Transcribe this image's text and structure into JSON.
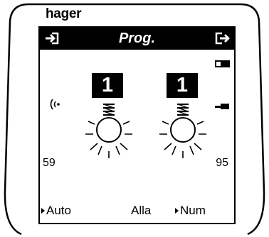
{
  "brand": "hager",
  "title": "Prog.",
  "icons": {
    "left": "login-arrow-icon",
    "right": "exit-arrow-icon",
    "battery": "battery-icon",
    "signal": "radio-signal-icon",
    "level": "level-bar-icon",
    "bulb": "light-bulb-icon"
  },
  "channels": [
    {
      "value": "1"
    },
    {
      "value": "1"
    }
  ],
  "numbers": {
    "left": "59",
    "right": "95"
  },
  "footer": {
    "auto": "Auto",
    "alla": "Alla",
    "num": "Num"
  },
  "colors": {
    "foreground": "#000000",
    "background": "#ffffff"
  }
}
